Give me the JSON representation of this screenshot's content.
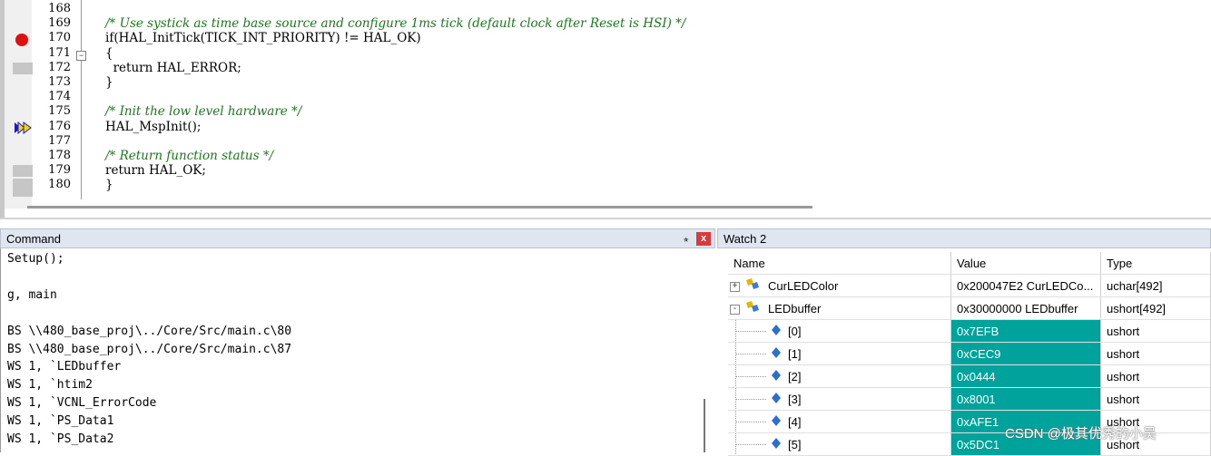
{
  "editor": {
    "lines": [
      {
        "num": "168",
        "text": ""
      },
      {
        "num": "169",
        "text": "/* Use systick as time base source and configure 1ms tick (default clock after Reset is HSI) */",
        "comment": true
      },
      {
        "num": "170",
        "text": "if(HAL_InitTick(TICK_INT_PRIORITY) != HAL_OK)"
      },
      {
        "num": "171",
        "text": "{"
      },
      {
        "num": "172",
        "text": "  return HAL_ERROR;"
      },
      {
        "num": "173",
        "text": "}"
      },
      {
        "num": "174",
        "text": ""
      },
      {
        "num": "175",
        "text": "/* Init the low level hardware */",
        "comment": true
      },
      {
        "num": "176",
        "text": "HAL_MspInit();"
      },
      {
        "num": "177",
        "text": ""
      },
      {
        "num": "178",
        "text": "/* Return function status */",
        "comment": true
      },
      {
        "num": "179",
        "text": "return HAL_OK;"
      },
      {
        "num": "180",
        "text": "}"
      }
    ],
    "breakpoint_color": "#e01010",
    "comment_color": "#1a7a1a"
  },
  "command": {
    "title": "Command",
    "pin_glyph": "⭒",
    "close_glyph": "x",
    "lines": [
      "Setup();",
      "",
      "g, main",
      "",
      "BS \\\\480_base_proj\\../Core/Src/main.c\\80",
      "BS \\\\480_base_proj\\../Core/Src/main.c\\87",
      "WS 1, `LEDbuffer",
      "WS 1, `htim2",
      "WS 1, `VCNL_ErrorCode",
      "WS 1, `PS_Data1",
      "WS 1, `PS_Data2"
    ]
  },
  "watch": {
    "title": "Watch 2",
    "headers": {
      "name": "Name",
      "value": "Value",
      "type": "Type"
    },
    "rows": [
      {
        "name": "CurLEDColor",
        "value": "0x200047E2 CurLEDCo...",
        "type": "uchar[492]",
        "level": 0,
        "expander": "+"
      },
      {
        "name": "LEDbuffer",
        "value": "0x30000000 LEDbuffer",
        "type": "ushort[492]",
        "level": 0,
        "expander": "-"
      },
      {
        "name": "[0]",
        "value": "0x7EFB",
        "type": "ushort",
        "level": 1,
        "changed": true
      },
      {
        "name": "[1]",
        "value": "0xCEC9",
        "type": "ushort",
        "level": 1,
        "changed": true
      },
      {
        "name": "[2]",
        "value": "0x0444",
        "type": "ushort",
        "level": 1,
        "changed": true
      },
      {
        "name": "[3]",
        "value": "0x8001",
        "type": "ushort",
        "level": 1,
        "changed": true
      },
      {
        "name": "[4]",
        "value": "0xAFE1",
        "type": "ushort",
        "level": 1,
        "changed": true
      },
      {
        "name": "[5]",
        "value": "0x5DC1",
        "type": "ushort",
        "level": 1,
        "changed": true
      }
    ],
    "changed_color": "#00a39b"
  },
  "watermark": "CSDN @极其优秀的小吴"
}
